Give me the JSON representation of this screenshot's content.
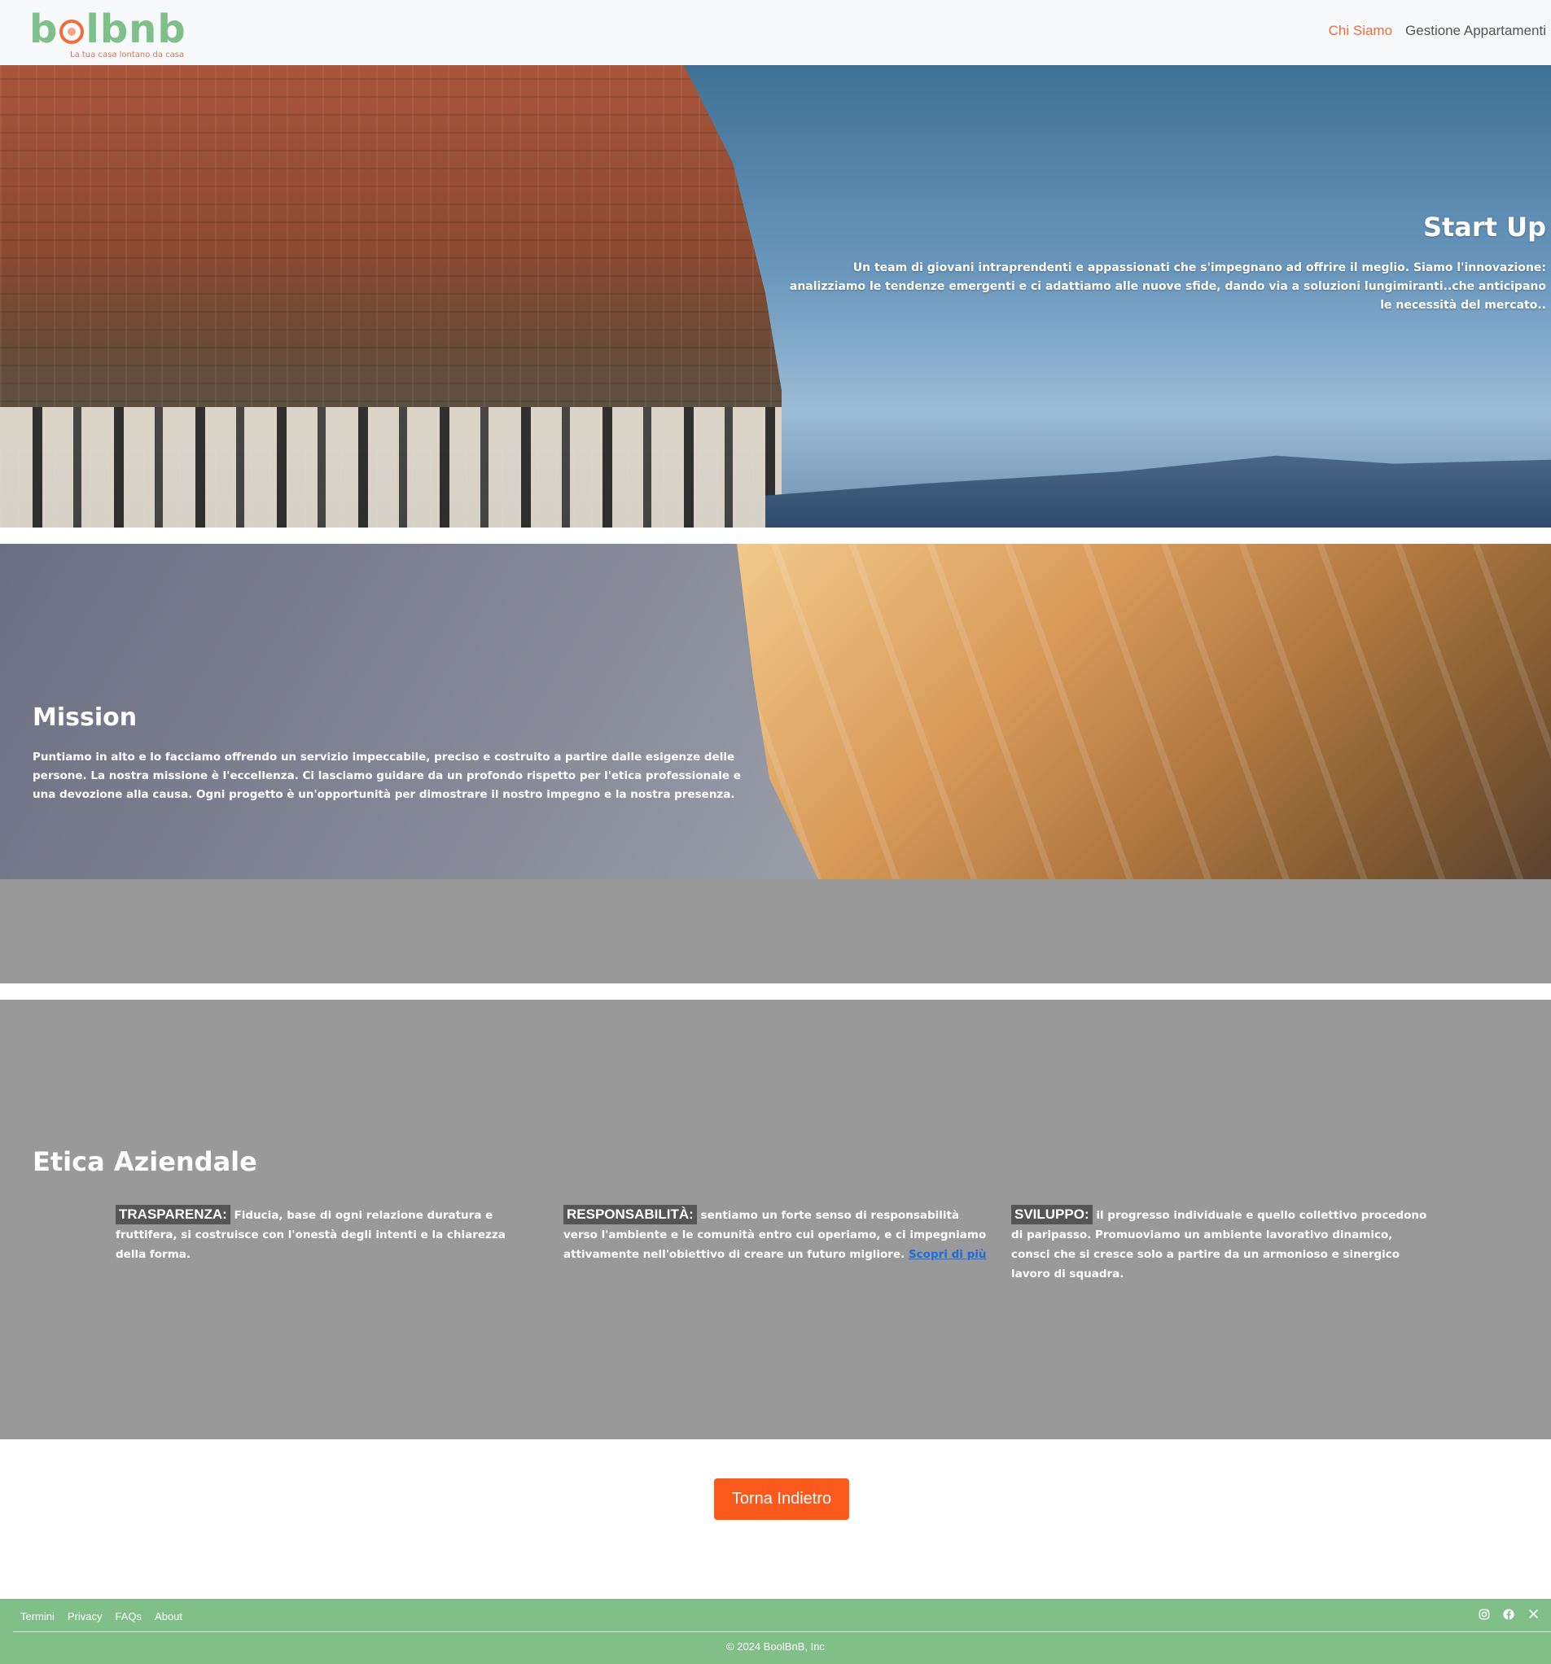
{
  "brand": {
    "logo_prefix": "b",
    "logo_suffix": "lbnb",
    "tagline": "La tua casa lontano da casa"
  },
  "nav": {
    "items": [
      {
        "label": "Chi Siamo",
        "active": true
      },
      {
        "label": "Gestione Appartamenti",
        "active": false
      }
    ]
  },
  "startup": {
    "title": "Start Up",
    "text": "Un team di giovani intraprendenti e appassionati che s'impegnano ad offrire il meglio. Siamo l'innovazione: analizziamo le tendenze emergenti e ci adattiamo alle nuove sfide, dando via a soluzioni lungimiranti..che anticipano le necessità del mercato.."
  },
  "mission": {
    "title": "Mission",
    "text": "Puntiamo in alto e lo facciamo offrendo un servizio impeccabile, preciso e costruito a partire dalle esigenze delle persone. La nostra missione è l'eccellenza. Ci lasciamo guidare da un profondo rispetto per l'etica professionale e una devozione alla causa. Ogni progetto è un'opportunità per dimostrare il nostro impegno e la nostra presenza."
  },
  "etica": {
    "title": "Etica Aziendale",
    "values": [
      {
        "label": "TRASPARENZA:",
        "text": " Fiducia, base di ogni relazione duratura e fruttifera, si costruisce con l'onestà degli intenti e la chiarezza della forma."
      },
      {
        "label": "RESPONSABILITÀ:",
        "text": " sentiamo un forte senso di responsabilità verso l'ambiente e le comunità entro cui operiamo, e ci impegniamo attivamente nell'obiettivo di creare un futuro migliore. ",
        "link": "Scopri di più"
      },
      {
        "label": "SVILUPPO:",
        "text": " il progresso individuale e quello collettivo procedono di paripasso. Promuoviamo un ambiente lavorativo dinamico, consci che si cresce solo a partire da un armonioso e sinergico lavoro di squadra."
      }
    ]
  },
  "back_button": "Torna Indietro",
  "footer": {
    "links": [
      "Termini",
      "Privacy",
      "FAQs",
      "About"
    ],
    "social_icons": [
      "instagram-icon",
      "facebook-icon",
      "x-icon"
    ],
    "copyright": "© 2024 BoolBnB, Inc"
  },
  "colors": {
    "accent": "#fc5a1d",
    "brand_green": "#7fbf8a",
    "footer_green": "#80bf88",
    "section_grey": "#999999",
    "link_blue": "#1a6ee0"
  }
}
